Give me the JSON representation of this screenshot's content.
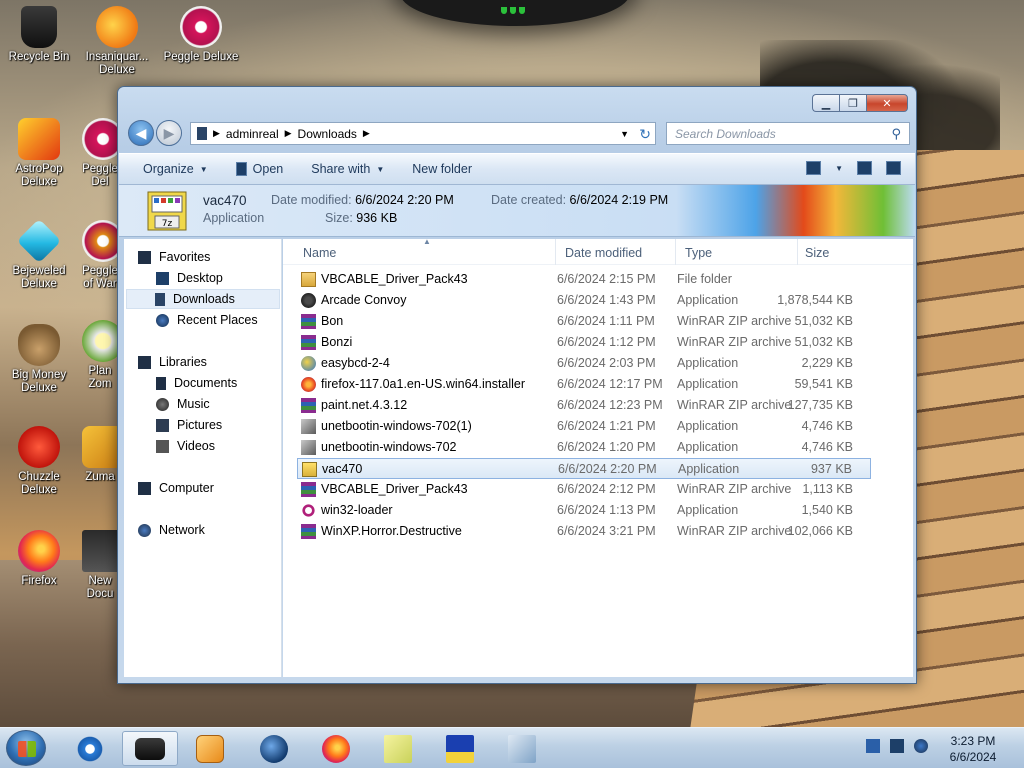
{
  "desktop": {
    "icons": [
      {
        "label": "Recycle Bin"
      },
      {
        "label": "Insaniquar... Deluxe"
      },
      {
        "label": "Peggle Deluxe"
      },
      {
        "label": "AstroPop Deluxe"
      },
      {
        "label": "Peggle Del"
      },
      {
        "label": "Bejeweled Deluxe"
      },
      {
        "label": "Peggle of War"
      },
      {
        "label": "Big Money Deluxe"
      },
      {
        "label": "Plan Zom"
      },
      {
        "label": "Chuzzle Deluxe"
      },
      {
        "label": "Zuma"
      },
      {
        "label": "Firefox"
      },
      {
        "label": "New Docu"
      }
    ]
  },
  "window": {
    "address": {
      "crumbs": [
        "adminreal",
        "Downloads"
      ]
    },
    "search": {
      "placeholder": "Search Downloads"
    },
    "toolbar": {
      "organize": "Organize",
      "open": "Open",
      "share": "Share with",
      "new_folder": "New folder"
    },
    "preview": {
      "name": "vac470",
      "kind": "Application",
      "modified_label": "Date modified:",
      "modified": "6/6/2024 2:20 PM",
      "size_label": "Size:",
      "size": "936 KB",
      "created_label": "Date created:",
      "created": "6/6/2024 2:19 PM"
    },
    "nav": {
      "favorites": "Favorites",
      "desktop": "Desktop",
      "downloads": "Downloads",
      "recent": "Recent Places",
      "libraries": "Libraries",
      "documents": "Documents",
      "music": "Music",
      "pictures": "Pictures",
      "videos": "Videos",
      "computer": "Computer",
      "network": "Network"
    },
    "columns": {
      "name": "Name",
      "date": "Date modified",
      "type": "Type",
      "size": "Size"
    },
    "files": [
      {
        "name": "VBCABLE_Driver_Pack43",
        "date": "6/6/2024 2:15 PM",
        "type": "File folder",
        "size": "",
        "icon": "folder-icon"
      },
      {
        "name": "Arcade Convoy",
        "date": "6/6/2024 1:43 PM",
        "type": "Application",
        "size": "1,878,544 KB",
        "icon": "app-icon"
      },
      {
        "name": "Bon",
        "date": "6/6/2024 1:11 PM",
        "type": "WinRAR ZIP archive",
        "size": "51,032 KB",
        "icon": "zip-icon"
      },
      {
        "name": "Bonzi",
        "date": "6/6/2024 1:12 PM",
        "type": "WinRAR ZIP archive",
        "size": "51,032 KB",
        "icon": "zip-icon"
      },
      {
        "name": "easybcd-2-4",
        "date": "6/6/2024 2:03 PM",
        "type": "Application",
        "size": "2,229 KB",
        "icon": "installer-icon"
      },
      {
        "name": "firefox-117.0a1.en-US.win64.installer",
        "date": "6/6/2024 12:17 PM",
        "type": "Application",
        "size": "59,541 KB",
        "icon": "firefox-icon"
      },
      {
        "name": "paint.net.4.3.12",
        "date": "6/6/2024 12:23 PM",
        "type": "WinRAR ZIP archive",
        "size": "127,735 KB",
        "icon": "zip-icon"
      },
      {
        "name": "unetbootin-windows-702(1)",
        "date": "6/6/2024 1:21 PM",
        "type": "Application",
        "size": "4,746 KB",
        "icon": "unetbootin-icon"
      },
      {
        "name": "unetbootin-windows-702",
        "date": "6/6/2024 1:20 PM",
        "type": "Application",
        "size": "4,746 KB",
        "icon": "unetbootin-icon"
      },
      {
        "name": "vac470",
        "date": "6/6/2024 2:20 PM",
        "type": "Application",
        "size": "937 KB",
        "icon": "7z-icon"
      },
      {
        "name": "VBCABLE_Driver_Pack43",
        "date": "6/6/2024 2:12 PM",
        "type": "WinRAR ZIP archive",
        "size": "1,113 KB",
        "icon": "zip-icon"
      },
      {
        "name": "win32-loader",
        "date": "6/6/2024 1:13 PM",
        "type": "Application",
        "size": "1,540 KB",
        "icon": "debian-icon"
      },
      {
        "name": "WinXP.Horror.Destructive",
        "date": "6/6/2024 3:21 PM",
        "type": "WinRAR ZIP archive",
        "size": "102,066 KB",
        "icon": "zip-icon"
      }
    ],
    "selected_file": "vac470"
  },
  "taskbar": {
    "time": "3:23 PM",
    "date": "6/6/2024"
  }
}
